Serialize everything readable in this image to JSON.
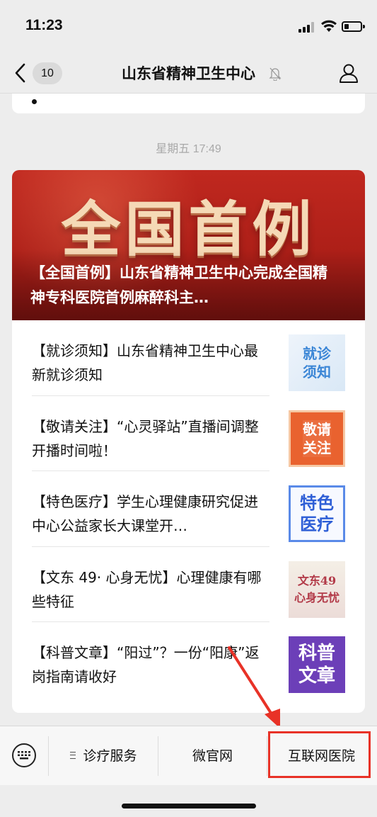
{
  "status_bar": {
    "time": "11:23"
  },
  "nav": {
    "unread_count": "10",
    "title": "山东省精神卫生中心"
  },
  "chat": {
    "date_separator": "星期五 17:49"
  },
  "article": {
    "cover_banner_text": "全国首例",
    "cover_title": "【全国首例】山东省精神卫生中心完成全国精神专科医院首例麻醉科主…",
    "items": [
      {
        "title": "【就诊须知】山东省精神卫生中心最新就诊须知",
        "thumb_text": "就诊\n须知"
      },
      {
        "title": "【敬请关注】“心灵驿站”直播间调整开播时间啦！",
        "thumb_text": "敬请\n关注"
      },
      {
        "title": "【特色医疗】学生心理健康研究促进中心公益家长大课堂开…",
        "thumb_text": "特色\n医疗"
      },
      {
        "title": "【文东 49· 心身无忧】心理健康有哪些特征",
        "thumb_text": "文东49\n心身无忧"
      },
      {
        "title": "【科普文章】“阳过”？一份“阳康”返岗指南请收好",
        "thumb_text": "科普\n文章"
      }
    ]
  },
  "menu": {
    "items": [
      "诊疗服务",
      "微官网",
      "互联网医院"
    ]
  },
  "colors": {
    "annotation_red": "#e83227",
    "cover_red": "#b3231b",
    "background": "#ededed"
  },
  "icons": {
    "back": "chevron-left-icon",
    "mute": "bell-slash-icon",
    "profile": "person-icon",
    "keyboard": "keyboard-icon",
    "menu": "menu-lines-icon"
  }
}
